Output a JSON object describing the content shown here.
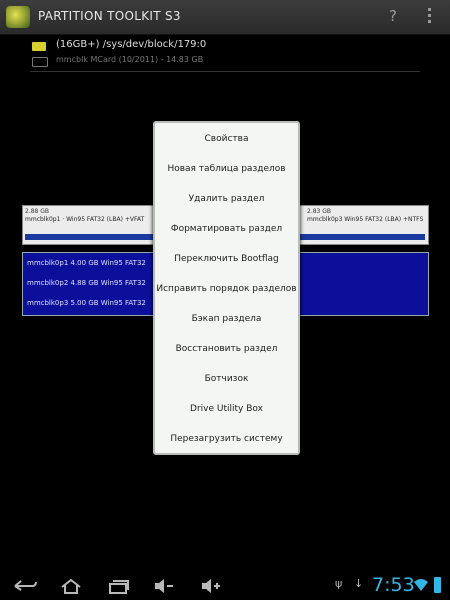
{
  "app": {
    "title": "PARTITION TOOLKIT S3",
    "help_glyph": "?"
  },
  "device": {
    "path": "(16GB+) /sys/dev/block/179:0",
    "info": "mmcblk MCard (10/2011) - 14.83 GB"
  },
  "partition_bar": {
    "left_size": "2.88 GB",
    "left_label": "mmcblk0p1 · Win95 FAT32 (LBA) +VFAT",
    "right_size": "2.83 GB",
    "right_label": "mmcblk0p3 Win95 FAT32 (LBA) +NTFS"
  },
  "partition_list": [
    "mmcblk0p1  4.00 GB  Win95 FAT32",
    "mmcblk0p2  4.88 GB  Win95 FAT32",
    "mmcblk0p3  5.00 GB  Win95 FAT32"
  ],
  "menu": {
    "items": [
      "Свойства",
      "Новая таблица разделов",
      "Удалить раздел",
      "Форматировать раздел",
      "Переключить Bootflag",
      "Исправить порядок разделов",
      "Бэкап раздела",
      "Восстановить раздел",
      "Ботчизок",
      "Drive Utility Box",
      "Перезагрузить систему"
    ]
  },
  "status": {
    "time": "7:53"
  },
  "icons": {
    "back": "back-icon",
    "home": "home-icon",
    "recent": "recent-apps-icon",
    "volume_down": "volume-down-icon",
    "volume_up": "volume-up-icon",
    "usb": "usb-icon",
    "download": "download-icon",
    "wifi": "wifi-icon",
    "battery": "battery-icon"
  },
  "colors": {
    "accent": "#33b5e5",
    "partition_list_bg": "#0b0f9a",
    "popup_bg": "#f4f6f4"
  }
}
